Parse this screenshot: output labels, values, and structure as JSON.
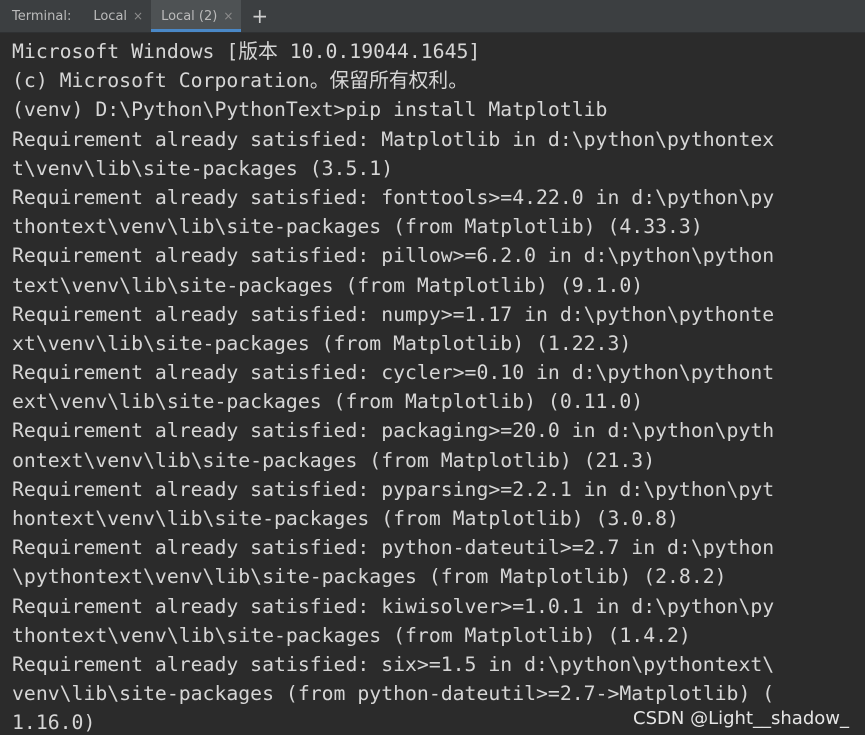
{
  "tabbar": {
    "title": "Terminal:",
    "tabs": [
      {
        "label": "Local",
        "close": "×"
      },
      {
        "label": "Local (2)",
        "close": "×",
        "active": true
      }
    ],
    "add_label": "+"
  },
  "terminal": {
    "lines": [
      "Microsoft Windows [版本 10.0.19044.1645]",
      "(c) Microsoft Corporation。保留所有权利。",
      "(venv) D:\\Python\\PythonText>pip install Matplotlib",
      "Requirement already satisfied: Matplotlib in d:\\python\\pythontex",
      "t\\venv\\lib\\site-packages (3.5.1)",
      "Requirement already satisfied: fonttools>=4.22.0 in d:\\python\\py",
      "thontext\\venv\\lib\\site-packages (from Matplotlib) (4.33.3)",
      "Requirement already satisfied: pillow>=6.2.0 in d:\\python\\python",
      "text\\venv\\lib\\site-packages (from Matplotlib) (9.1.0)",
      "Requirement already satisfied: numpy>=1.17 in d:\\python\\pythonte",
      "xt\\venv\\lib\\site-packages (from Matplotlib) (1.22.3)",
      "Requirement already satisfied: cycler>=0.10 in d:\\python\\pythont",
      "ext\\venv\\lib\\site-packages (from Matplotlib) (0.11.0)",
      "Requirement already satisfied: packaging>=20.0 in d:\\python\\pyth",
      "ontext\\venv\\lib\\site-packages (from Matplotlib) (21.3)",
      "Requirement already satisfied: pyparsing>=2.2.1 in d:\\python\\pyt",
      "hontext\\venv\\lib\\site-packages (from Matplotlib) (3.0.8)",
      "Requirement already satisfied: python-dateutil>=2.7 in d:\\python",
      "\\pythontext\\venv\\lib\\site-packages (from Matplotlib) (2.8.2)",
      "Requirement already satisfied: kiwisolver>=1.0.1 in d:\\python\\py",
      "thontext\\venv\\lib\\site-packages (from Matplotlib) (1.4.2)",
      "Requirement already satisfied: six>=1.5 in d:\\python\\pythontext\\",
      "venv\\lib\\site-packages (from python-dateutil>=2.7->Matplotlib) (",
      "1.16.0)"
    ]
  },
  "watermark": "CSDN @Light__shadow_",
  "colors": {
    "background": "#2b2b2b",
    "tabbar": "#3c3f41",
    "active_tab": "#4e5254",
    "active_underline": "#4a88c7",
    "text": "#d6d6d6"
  }
}
